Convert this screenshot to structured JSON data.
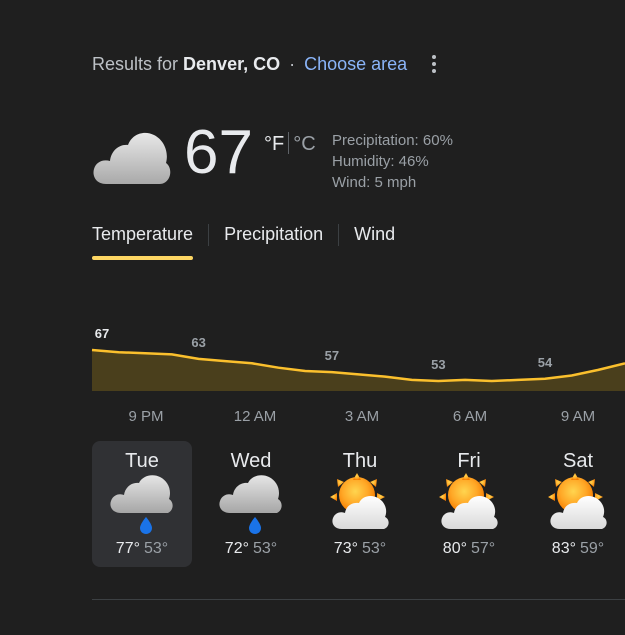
{
  "header": {
    "results_prefix": "Results for",
    "location": "Denver, CO",
    "separator": "·",
    "choose_area": "Choose area"
  },
  "current": {
    "icon": "cloud-icon",
    "temperature": "67",
    "unit_f": "°F",
    "unit_c": "°C",
    "precipitation": "Precipitation: 60%",
    "humidity": "Humidity: 46%",
    "wind": "Wind: 5 mph"
  },
  "tabs": [
    {
      "label": "Temperature",
      "active": true
    },
    {
      "label": "Precipitation",
      "active": false
    },
    {
      "label": "Wind",
      "active": false
    }
  ],
  "chart_data": {
    "type": "area",
    "x": [
      "9 PM",
      "12 AM",
      "3 AM",
      "6 AM",
      "9 AM"
    ],
    "curve": [
      67,
      66,
      65.5,
      65,
      63,
      62,
      61,
      59,
      57.5,
      57,
      56,
      55,
      53.5,
      53,
      53.5,
      53,
      53.5,
      54,
      55.5,
      58,
      61
    ],
    "value_labels": [
      {
        "text": "67",
        "value": 67,
        "index": 0
      },
      {
        "text": "63",
        "value": 63,
        "index": 4
      },
      {
        "text": "57",
        "value": 57,
        "index": 9
      },
      {
        "text": "53",
        "value": 53,
        "index": 13
      },
      {
        "text": "54",
        "value": 54,
        "index": 17
      }
    ],
    "line_color": "#fbc02d",
    "fill_color": "#4a3f1c"
  },
  "days": [
    {
      "name": "Tue",
      "high": "77°",
      "low": "53°",
      "icon": "cloud-rain-icon",
      "selected": true
    },
    {
      "name": "Wed",
      "high": "72°",
      "low": "53°",
      "icon": "cloud-rain-icon",
      "selected": false
    },
    {
      "name": "Thu",
      "high": "73°",
      "low": "53°",
      "icon": "partly-cloudy-icon",
      "selected": false
    },
    {
      "name": "Fri",
      "high": "80°",
      "low": "57°",
      "icon": "partly-cloudy-icon",
      "selected": false
    },
    {
      "name": "Sat",
      "high": "83°",
      "low": "59°",
      "icon": "partly-cloudy-icon",
      "selected": false
    }
  ]
}
